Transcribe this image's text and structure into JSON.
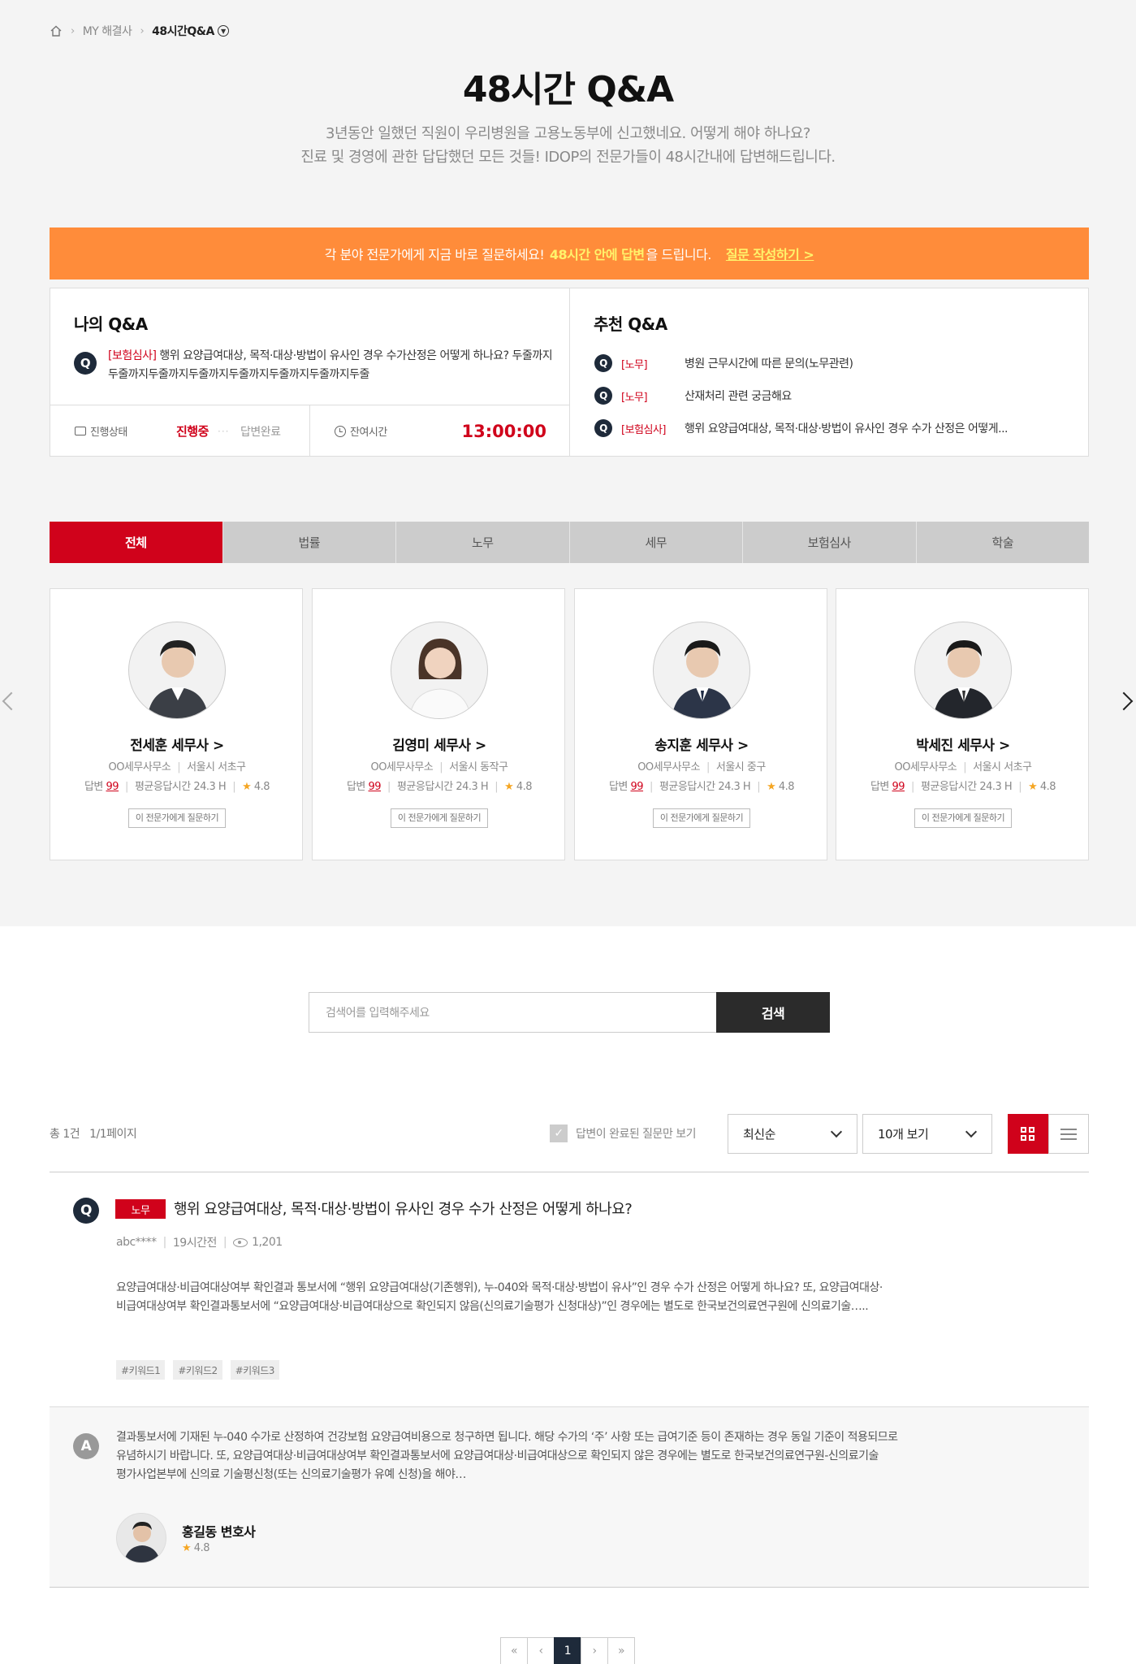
{
  "breadcrumb": {
    "home_icon": "home-icon",
    "parent": "MY 해결사",
    "current": "48시간Q&A"
  },
  "header": {
    "title": "48시간 Q&A",
    "desc_line1": "3년동안 일했던 직원이 우리병원을 고용노동부에 신고했네요. 어떻게 해야 하나요?",
    "desc_line2": "진료 및 경영에 관한 답답했던 모든 것들! IDOP의 전문가들이 48시간내에 답변해드립니다."
  },
  "banner": {
    "text_before": "각 분야 전문가에게 지금 바로 질문하세요!",
    "highlight": "48시간 안에 답변",
    "text_after": "을 드립니다.",
    "cta": "질문 작성하기 >",
    "bg_color": "#ff8c3a"
  },
  "my_qa": {
    "title": "나의 Q&A",
    "tag": "[보험심사]",
    "question": " 행위 요양급여대상, 목적·대상·방법이 유사인 경우 수가산정은 어떻게 하나요? 두줄까지두줄까지두줄까지두줄까지두줄까지두줄까지두줄까지두줄",
    "status_label": "진행상태",
    "status_active": "진행중",
    "status_done": "답변완료",
    "remain_label": "잔여시간",
    "timer": "13:00:00"
  },
  "rec_qa": {
    "title": "추천 Q&A",
    "items": [
      {
        "tag": "[노무]",
        "text": "병원 근무시간에 따른 문의(노무관련)"
      },
      {
        "tag": "[노무]",
        "text": "산재처리 관련 궁금해요"
      },
      {
        "tag": "[보험심사]",
        "text": "행위 요양급여대상, 목적·대상·방법이 유사인 경우 수가 산정은 어떻게..."
      }
    ]
  },
  "tabs": [
    "전체",
    "법률",
    "노무",
    "세무",
    "보험심사",
    "학술"
  ],
  "experts": [
    {
      "name": "전세훈 세무사 >",
      "office": "OO세무사무소",
      "region": "서울시 서초구",
      "answers_label": "답변",
      "answers": "99",
      "avg_label": "평균응답시간 24.3 H",
      "rating": "4.8",
      "button": "이 전문가에게 질문하기"
    },
    {
      "name": "김영미 세무사 >",
      "office": "OO세무사무소",
      "region": "서울시 동작구",
      "answers_label": "답변",
      "answers": "99",
      "avg_label": "평균응답시간 24.3 H",
      "rating": "4.8",
      "button": "이 전문가에게 질문하기"
    },
    {
      "name": "송지훈 세무사 >",
      "office": "OO세무사무소",
      "region": "서울시 중구",
      "answers_label": "답변",
      "answers": "99",
      "avg_label": "평균응답시간 24.3 H",
      "rating": "4.8",
      "button": "이 전문가에게 질문하기"
    },
    {
      "name": "박세진 세무사 >",
      "office": "OO세무사무소",
      "region": "서울시 서초구",
      "answers_label": "답변",
      "answers": "99",
      "avg_label": "평균응답시간 24.3 H",
      "rating": "4.8",
      "button": "이 전문가에게 질문하기"
    }
  ],
  "search": {
    "placeholder": "검색어를 입력해주세요",
    "button": "검색"
  },
  "list": {
    "total": "총 1건",
    "page_info": "1/1페이지",
    "filter_label": "답변이 완료된 질문만 보기",
    "sort": "최신순",
    "per_page": "10개 보기"
  },
  "question": {
    "category": "노무",
    "title": "행위 요양급여대상, 목적·대상·방법이 유사인 경우 수가 산정은 어떻게 하나요?",
    "author": "abc****",
    "time": "19시간전",
    "views": "1,201",
    "body_line1": "요양급여대상·비급여대상여부 확인결과 통보서에 “행위 요양급여대상(기존행위), 누-040와 목적·대상·방법이 유사”인 경우 수가 산정은 어떻게 하나요? 또, 요양급여대상·",
    "body_line2": "비급여대상여부 확인결과통보서에 “요양급여대상·비급여대상으로 확인되지 않음(신의료기술평가 신청대상)”인 경우에는 별도로 한국보건의료연구원에 신의료기술…..",
    "tags": [
      "#키워드1",
      "#키워드2",
      "#키워드3"
    ]
  },
  "answer": {
    "line1": "결과통보서에 기재된 누-040 수가로 산정하여 건강보험 요양급여비용으로 청구하면 됩니다. 해당 수가의 ‘주’ 사항 또는 급여기준 등이 존재하는 경우 동일 기준이 적용되므로",
    "line2": "유념하시기 바랍니다. 또, 요양급여대상·비급여대상여부 확인결과통보서에 요양급여대상·비급여대상으로 확인되지 않은 경우에는 별도로 한국보건의료연구원-신의료기술",
    "line3": "평가사업본부에 신의료 기술평신청(또는 신의료기술평가 유예 신청)을 해야…",
    "expert_name": "홍길동 변호사",
    "rating": "4.8"
  },
  "pagination": {
    "first": "«",
    "prev": "‹",
    "current": "1",
    "next": "›",
    "last": "»"
  },
  "colors": {
    "accent": "#d0021b",
    "navy": "#1e2a3a",
    "orange": "#ff8c3a",
    "star": "#f5a623"
  }
}
